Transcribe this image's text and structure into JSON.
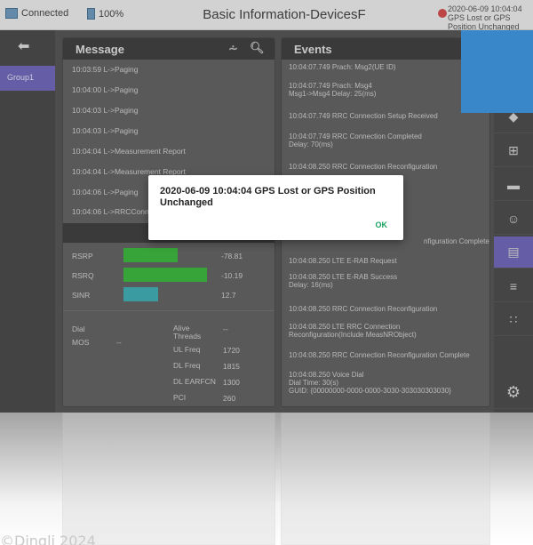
{
  "topbar": {
    "connection": "Connected",
    "battery": "100%",
    "title": "Basic Information-DevicesF",
    "alert": "2020-06-09  10:04:04 GPS Lost or GPS Position Unchanged"
  },
  "nav": {
    "group": "Group1"
  },
  "message_panel": {
    "title": "Message",
    "rows": [
      "10:03:59  L->Paging",
      "10:04:00  L->Paging",
      "10:04:03  L->Paging",
      "10:04:03  L->Paging",
      "10:04:04  L->Measurement Report",
      "10:04:04  L->Measurement Report",
      "10:04:06  L->Paging",
      "10:04:06  L->RRCConne"
    ],
    "metrics": [
      {
        "name": "RSRP",
        "value": "-78.81",
        "fill": 0.55,
        "color": "#19b21c"
      },
      {
        "name": "RSRQ",
        "value": "-10.19",
        "fill": 0.85,
        "color": "#19b21c"
      },
      {
        "name": "SINR",
        "value": "12.7",
        "fill": 0.35,
        "color": "#1fa6ad"
      }
    ],
    "dial": {
      "label": "Dial",
      "mos_label": "MOS",
      "mos_value": "--"
    },
    "params": [
      {
        "name": "Alive Threads",
        "value": "--"
      },
      {
        "name": "UL Freq",
        "value": "1720"
      },
      {
        "name": "DL Freq",
        "value": "1815"
      },
      {
        "name": "DL EARFCN",
        "value": "1300"
      },
      {
        "name": "PCI",
        "value": "260"
      }
    ]
  },
  "events_panel": {
    "title": "Events",
    "rows": [
      "10:04:07.749  Prach: Msg2(UE ID)",
      "10:04:07.749  Prach: Msg4\nMsg1->Msg4 Delay: 25(ms)",
      "10:04:07.749  RRC Connection Setup Received",
      "10:04:07.749  RRC Connection Completed\nDelay: 70(ms)",
      "10:04:08.250  RRC Connection Reconfiguration",
      "nfiguration Complete",
      "10:04:08.250  LTE E-RAB Request",
      "10:04:08.250  LTE E-RAB Success\nDelay: 16(ms)",
      "10:04:08.250  RRC Connection Reconfiguration",
      "10:04:08.250  LTE RRC Connection\nReconfiguration(Include MeasNRObject)",
      "10:04:08.250  RRC Connection Reconfiguration Complete",
      "10:04:08.250  Voice Dial\nDial Time: 30(s)\nGUID: {00000000-0000-0000-3030-303030303030}"
    ]
  },
  "dialog": {
    "message": "2020-06-09  10:04:04  GPS Lost or GPS Position Unchanged",
    "ok": "OK"
  },
  "watermark": "©Dingli 2024"
}
